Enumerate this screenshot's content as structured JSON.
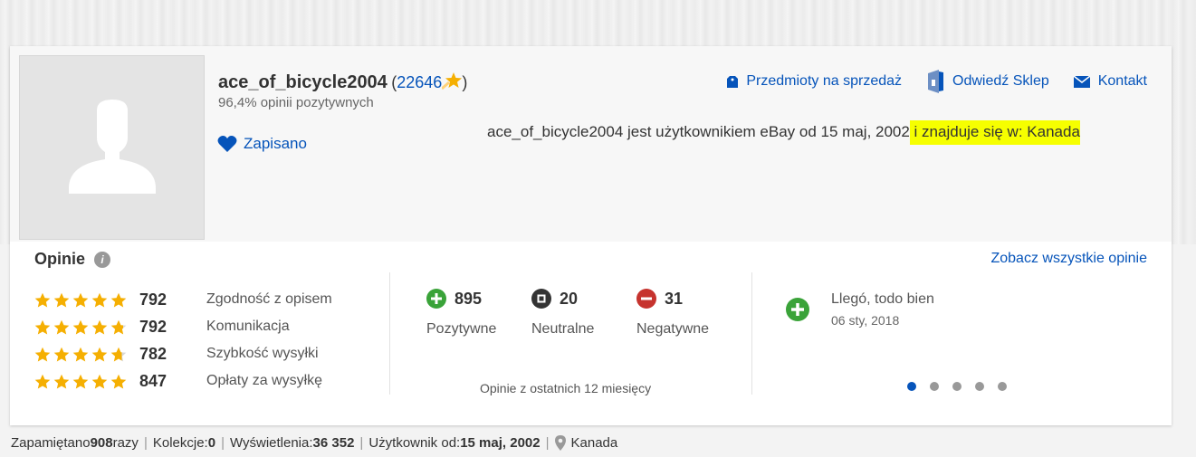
{
  "profile": {
    "username": "ace_of_bicycle2004",
    "open_paren": "(",
    "feedback_score": "22646",
    "close_paren": ")",
    "positive_percent": "96,4% opinii pozytywnych",
    "saved_label": "Zapisano",
    "member_text": "ace_of_bicycle2004 jest użytkownikiem eBay od 15 maj, 2002",
    "location_text_a": " i znajduje się w",
    "location_text_b": ": Kanada"
  },
  "top_links": [
    {
      "label": "Przedmioty na sprzedaż",
      "icon": "tag-icon"
    },
    {
      "label": "Odwiedź Sklep",
      "icon": "store-icon"
    },
    {
      "label": "Kontakt",
      "icon": "envelope-icon"
    }
  ],
  "opinions": {
    "title": "Opinie",
    "see_all": "Zobacz wszystkie opinie",
    "detailed_ratings": [
      {
        "value": "792",
        "label": "Zgodność z opisem",
        "stars": 5.0
      },
      {
        "value": "792",
        "label": "Komunikacja",
        "stars": 4.8
      },
      {
        "value": "782",
        "label": "Szybkość wysyłki",
        "stars": 4.7
      },
      {
        "value": "847",
        "label": "Opłaty za wysyłkę",
        "stars": 5.0
      }
    ],
    "counts": [
      {
        "value": "895",
        "label": "Pozytywne",
        "type": "positive"
      },
      {
        "value": "20",
        "label": "Neutralne",
        "type": "neutral"
      },
      {
        "value": "31",
        "label": "Negatywne",
        "type": "negative"
      }
    ],
    "period_note": "Opinie z ostatnich 12 miesięcy",
    "latest_review": {
      "text": "Llegó, todo bien",
      "date": "06 sty, 2018"
    },
    "carousel_pages": 5,
    "carousel_active": 1
  },
  "footer": {
    "saved_prefix": "Zapamiętano ",
    "saved_count": "908",
    "saved_suffix": " razy",
    "collections_label": "Kolekcje: ",
    "collections_value": "0",
    "views_label": "Wyświetlenia: ",
    "views_value": "36 352",
    "member_since_label": "Użytkownik od: ",
    "member_since_value": "15 maj, 2002",
    "location": "Kanada",
    "separator": "|"
  },
  "colors": {
    "link": "#0654ba",
    "star": "#f5af02",
    "positive": "#3aa339",
    "neutral": "#333333",
    "negative": "#c6332e",
    "highlight": "#f6ff00"
  }
}
